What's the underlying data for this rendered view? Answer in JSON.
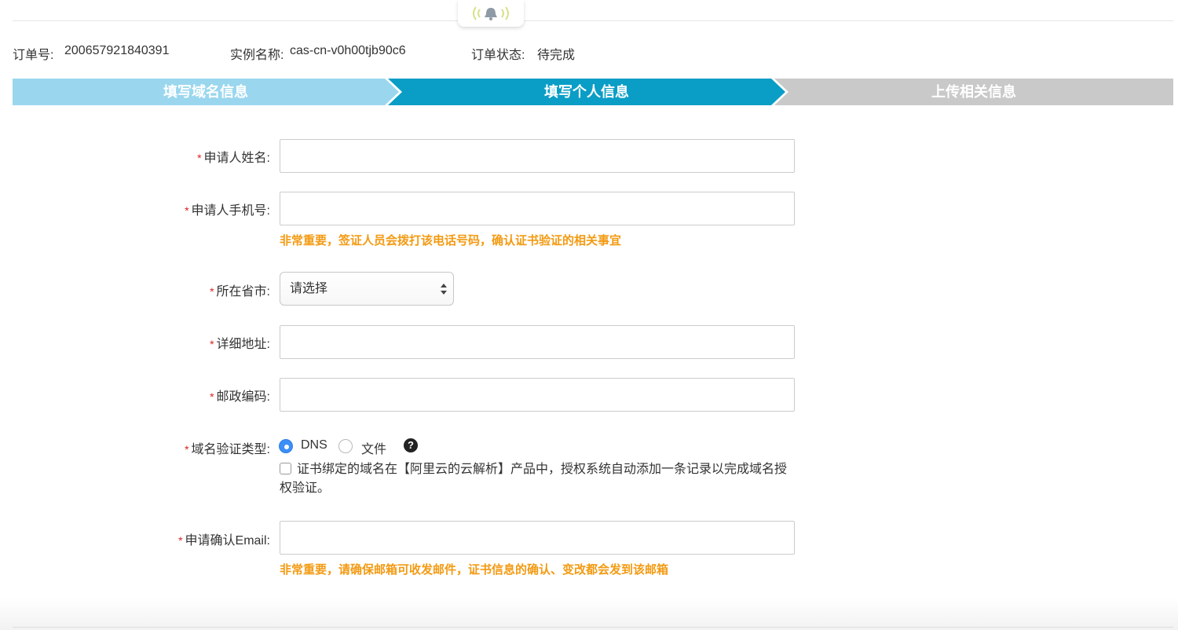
{
  "order": {
    "number_label": "订单号:",
    "number": "200657921840391",
    "instance_label": "实例名称:",
    "instance": "cas-cn-v0h00tjb90c6",
    "status_label": "订单状态:",
    "status": "待完成"
  },
  "steps": [
    "填写域名信息",
    "填写个人信息",
    "上传相关信息"
  ],
  "form": {
    "required_mark": "*",
    "applicant_name_label": "申请人姓名:",
    "applicant_phone_label": "申请人手机号:",
    "phone_hint": "非常重要，签证人员会拨打该电话号码，确认证书验证的相关事宜",
    "province_label": "所在省市:",
    "province_select": "请选择",
    "address_label": "详细地址:",
    "postcode_label": "邮政编码:",
    "verify_type_label": "域名验证类型:",
    "verify_options": [
      "DNS",
      "文件"
    ],
    "help_symbol": "?",
    "auto_dns_text": "证书绑定的域名在【阿里云的云解析】产品中，授权系统自动添加一条记录以完成域名授权验证。",
    "email_label": "申请确认Email:",
    "email_hint": "非常重要，请确保邮箱可收发邮件，证书信息的确认、变改都会发到该邮箱"
  },
  "colors": {
    "step_done": "#9ad7ee",
    "step_active": "#0a9ec6",
    "step_todo": "#c9c9c9",
    "hint": "#f39a12",
    "required": "#e02020",
    "radio_selected": "#3b8ff5"
  },
  "icons": {
    "bell": "bell-icon",
    "help": "question-circle-icon",
    "select_arrows": "updown-arrows-icon"
  }
}
